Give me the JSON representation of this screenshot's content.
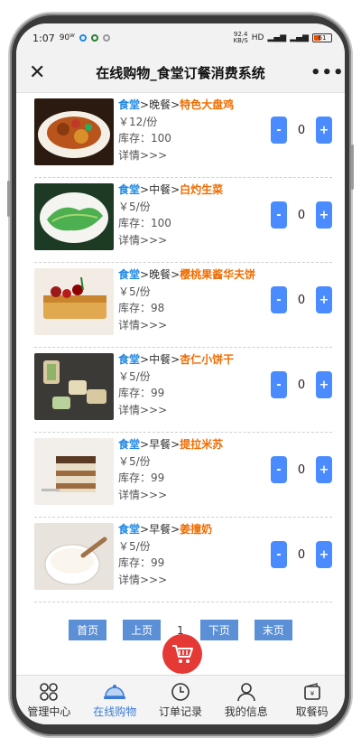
{
  "status": {
    "time": "1:07",
    "speed": "92.4\nKB/S",
    "net": "HD",
    "signal1": "4G",
    "signal2": "4G",
    "battery": "61"
  },
  "nav": {
    "title": "在线购物_食堂订餐消费系统",
    "close": "✕",
    "more": "•••"
  },
  "items": [
    {
      "area": "食堂",
      "meal": "晚餐",
      "name": "特色大盘鸡",
      "price": "￥12/份",
      "stock": "库存：100",
      "detail": "详情>>>",
      "qty": "0"
    },
    {
      "area": "食堂",
      "meal": "中餐",
      "name": "白灼生菜",
      "price": "￥5/份",
      "stock": "库存：100",
      "detail": "详情>>>",
      "qty": "0"
    },
    {
      "area": "食堂",
      "meal": "晚餐",
      "name": "樱桃果酱华夫饼",
      "price": "￥5/份",
      "stock": "库存：98",
      "detail": "详情>>>",
      "qty": "0"
    },
    {
      "area": "食堂",
      "meal": "中餐",
      "name": "杏仁小饼干",
      "price": "￥5/份",
      "stock": "库存：99",
      "detail": "详情>>>",
      "qty": "0"
    },
    {
      "area": "食堂",
      "meal": "早餐",
      "name": "提拉米苏",
      "price": "￥5/份",
      "stock": "库存：99",
      "detail": "详情>>>",
      "qty": "0"
    },
    {
      "area": "食堂",
      "meal": "早餐",
      "name": "姜撞奶",
      "price": "￥5/份",
      "stock": "库存：99",
      "detail": "详情>>>",
      "qty": "0"
    }
  ],
  "pager": {
    "first": "首页",
    "prev": "上页",
    "page": "1",
    "next": "下页",
    "last": "末页"
  },
  "tabs": [
    {
      "label": "管理中心"
    },
    {
      "label": "在线购物"
    },
    {
      "label": "订单记录"
    },
    {
      "label": "我的信息"
    },
    {
      "label": "取餐码"
    }
  ]
}
